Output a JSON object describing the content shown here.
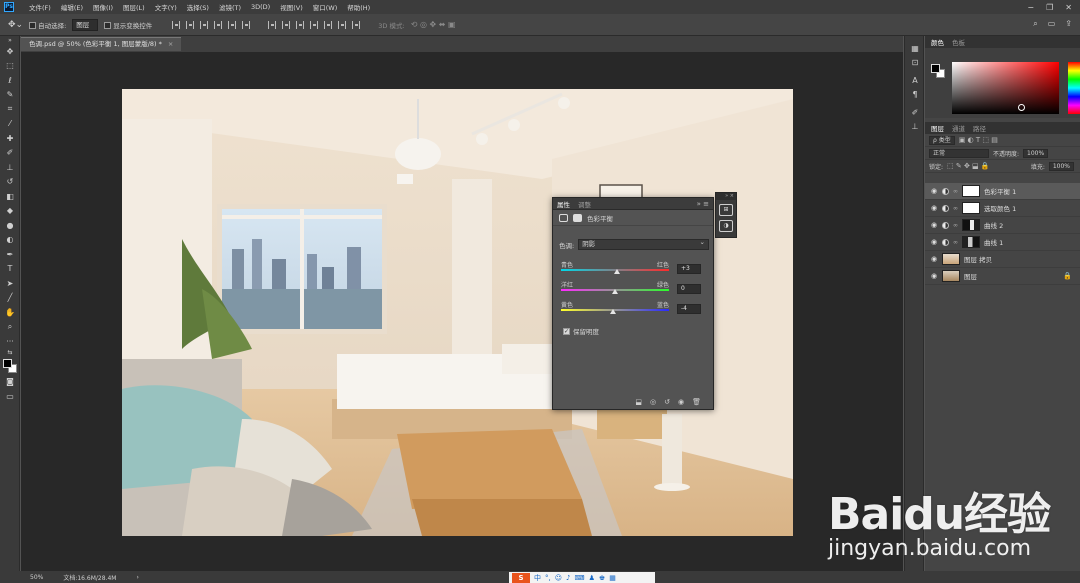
{
  "menubar": {
    "logo": "Ps",
    "items": [
      "文件(F)",
      "编辑(E)",
      "图像(I)",
      "图层(L)",
      "文字(Y)",
      "选择(S)",
      "滤镜(T)",
      "3D(D)",
      "视图(V)",
      "窗口(W)",
      "帮助(H)"
    ]
  },
  "options": {
    "auto_select": "自动选择:",
    "auto_select_value": "图层",
    "show_transform": "显示变换控件",
    "mode_3d": "3D 模式:"
  },
  "document": {
    "tab_title": "色调.psd @ 50% (色彩平衡 1, 图层蒙版/8) *",
    "zoom": "50%",
    "doc_info": "文档:16.6M/28.4M"
  },
  "properties": {
    "tab_properties": "属性",
    "tab_adjustments": "调整",
    "adjustment_name": "色彩平衡",
    "tone_label": "色调:",
    "tone_value": "阴影",
    "sliders": [
      {
        "left": "青色",
        "right": "红色",
        "value": "+3"
      },
      {
        "left": "洋红",
        "right": "绿色",
        "value": "0"
      },
      {
        "left": "黄色",
        "right": "蓝色",
        "value": "-4"
      }
    ],
    "preserve_luminosity": "保留明度"
  },
  "color_panel": {
    "tab_color": "颜色",
    "tab_swatches": "色板"
  },
  "layers_panel": {
    "tab_layers": "图层",
    "tab_channels": "通道",
    "tab_paths": "路径",
    "filter_kind": "ρ 类型",
    "blend_mode": "正常",
    "opacity_label": "不透明度:",
    "opacity_value": "100%",
    "lock_label": "锁定:",
    "fill_label": "填充:",
    "fill_value": "100%",
    "layers": [
      {
        "name": "色彩平衡 1",
        "type": "adjustment",
        "selected": true
      },
      {
        "name": "选取颜色 1",
        "type": "adjustment",
        "selected": false
      },
      {
        "name": "曲线 2",
        "type": "adjustment",
        "selected": false
      },
      {
        "name": "曲线 1",
        "type": "adjustment",
        "selected": false
      },
      {
        "name": "图层 拷贝",
        "type": "pixel",
        "selected": false
      },
      {
        "name": "图层",
        "type": "pixel",
        "selected": false
      }
    ]
  },
  "ime": {
    "brand": "S",
    "mode": "中",
    "punct": "°,"
  },
  "watermark": {
    "logo_text": "Baidu经验",
    "url": "jingyan.baidu.com"
  }
}
